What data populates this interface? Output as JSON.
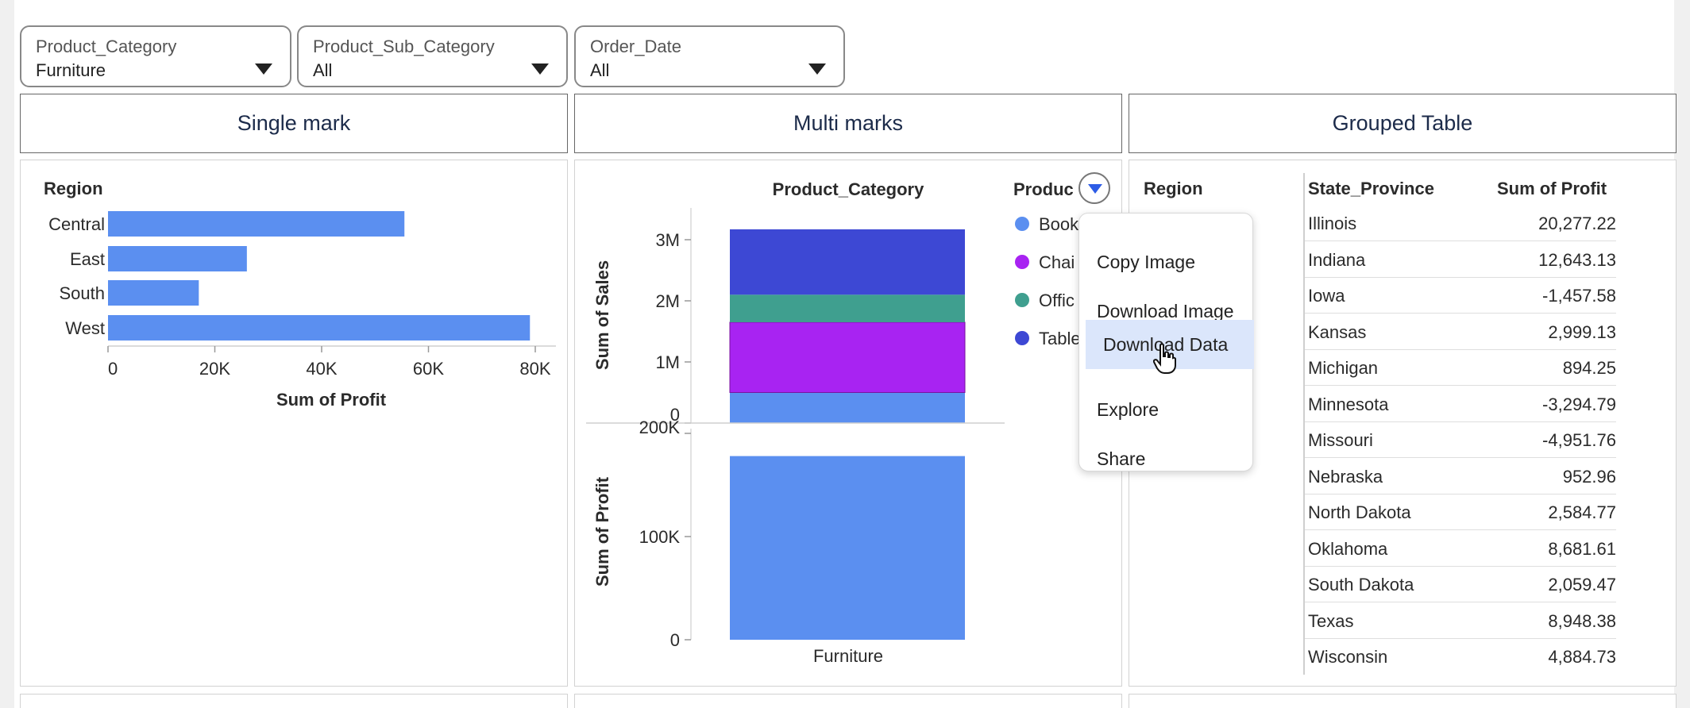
{
  "filters": [
    {
      "label": "Product_Category",
      "value": "Furniture"
    },
    {
      "label": "Product_Sub_Category",
      "value": "All"
    },
    {
      "label": "Order_Date",
      "value": "All"
    }
  ],
  "panels": {
    "single_mark_title": "Single mark",
    "multi_marks_title": "Multi marks",
    "grouped_table_title": "Grouped Table"
  },
  "chart_data": [
    {
      "type": "bar",
      "title": "",
      "ylabel": "Region",
      "xlabel": "Sum of Profit",
      "categories": [
        "Central",
        "East",
        "South",
        "West"
      ],
      "values": [
        55500,
        26000,
        17000,
        79000
      ],
      "xlim": [
        0,
        80000
      ],
      "ticks": [
        "0",
        "20K",
        "40K",
        "60K",
        "80K"
      ],
      "grid": false,
      "color": "#5b8ff0"
    },
    {
      "type": "bar",
      "stacked": true,
      "title": "Product_Category",
      "ylabel": "Sum of Sales",
      "categories": [
        "Furniture"
      ],
      "series": [
        {
          "name": "Book",
          "values": [
            500000
          ],
          "color": "#5b8ff0"
        },
        {
          "name": "Chai",
          "values": [
            1150000
          ],
          "color": "#a823f2"
        },
        {
          "name": "Offic",
          "values": [
            450000
          ],
          "color": "#3f9f8f"
        },
        {
          "name": "Table",
          "values": [
            1070000
          ],
          "color": "#3d48d4"
        }
      ],
      "ylim": [
        0,
        3200000
      ],
      "ticks": [
        "0",
        "1M",
        "2M",
        "3M"
      ],
      "legend_title": "Produc",
      "legend_position": "right"
    },
    {
      "type": "bar",
      "title": "",
      "ylabel": "Sum of Profit",
      "xlabel": "Furniture",
      "categories": [
        "Furniture"
      ],
      "values": [
        178000
      ],
      "ylim": [
        0,
        200000
      ],
      "ticks": [
        "0",
        "100K",
        "200K"
      ],
      "color": "#5b8ff0"
    }
  ],
  "grouped_table": {
    "columns": [
      "Region",
      "State_Province",
      "Sum of Profit"
    ],
    "rows": [
      {
        "state": "Illinois",
        "profit": "20,277.22"
      },
      {
        "state": "Indiana",
        "profit": "12,643.13"
      },
      {
        "state": "Iowa",
        "profit": "-1,457.58"
      },
      {
        "state": "Kansas",
        "profit": "2,999.13"
      },
      {
        "state": "Michigan",
        "profit": "894.25"
      },
      {
        "state": "Minnesota",
        "profit": "-3,294.79"
      },
      {
        "state": "Missouri",
        "profit": "-4,951.76"
      },
      {
        "state": "Nebraska",
        "profit": "952.96"
      },
      {
        "state": "North Dakota",
        "profit": "2,584.77"
      },
      {
        "state": "Oklahoma",
        "profit": "8,681.61"
      },
      {
        "state": "South Dakota",
        "profit": "2,059.47"
      },
      {
        "state": "Texas",
        "profit": "8,948.38"
      },
      {
        "state": "Wisconsin",
        "profit": "4,884.73"
      }
    ]
  },
  "context_menu": {
    "items": [
      "Copy Image",
      "Download Image",
      "Download Data",
      "Explore",
      "Share"
    ],
    "hovered": "Download Data"
  },
  "icons": {
    "filter_dropdown": "caret-down-icon",
    "legend_menu": "chevron-down-icon",
    "cursor": "hand-pointer-icon"
  },
  "colors": {
    "bar_primary": "#5b8ff0",
    "chairs": "#a823f2",
    "office": "#3f9f8f",
    "tables": "#3d48d4",
    "menu_hover": "#dbe6fb",
    "title_text": "#1c2b4a"
  }
}
